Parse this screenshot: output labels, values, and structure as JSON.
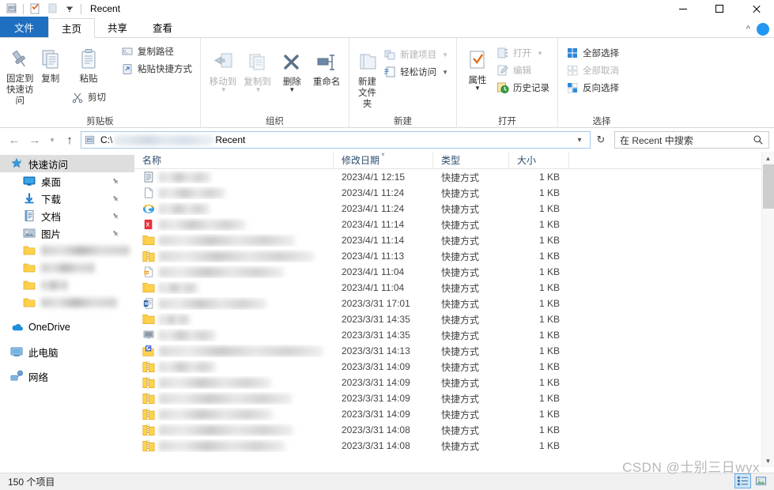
{
  "window": {
    "title": "Recent",
    "quick_access": [
      "properties-icon",
      "new-folder-icon",
      "customize-icon"
    ],
    "controls": {
      "minimize": "—",
      "maximize": "□",
      "close": "✕"
    }
  },
  "tabs": [
    {
      "id": "file",
      "label": "文件"
    },
    {
      "id": "home",
      "label": "主页"
    },
    {
      "id": "share",
      "label": "共享"
    },
    {
      "id": "view",
      "label": "查看"
    }
  ],
  "ribbon": {
    "groups": [
      {
        "title": "剪贴板",
        "big": [
          {
            "label": "固定到快速访问",
            "icon": "pin-icon"
          },
          {
            "label": "复制",
            "icon": "copy-icon"
          },
          {
            "label": "粘贴",
            "icon": "paste-icon"
          }
        ],
        "small_under_paste": [
          {
            "label": "剪切",
            "icon": "scissors-icon"
          }
        ],
        "small": [
          {
            "label": "复制路径",
            "icon": "copy-path-icon"
          },
          {
            "label": "粘贴快捷方式",
            "icon": "paste-shortcut-icon"
          }
        ]
      },
      {
        "title": "组织",
        "big": [
          {
            "label": "移动到",
            "icon": "move-to-icon",
            "has_caret": true,
            "disabled": true
          },
          {
            "label": "复制到",
            "icon": "copy-to-icon",
            "has_caret": true,
            "disabled": true
          },
          {
            "label": "删除",
            "icon": "delete-icon",
            "has_caret": true
          },
          {
            "label": "重命名",
            "icon": "rename-icon"
          }
        ]
      },
      {
        "title": "新建",
        "big": [
          {
            "label": "新建文件夹",
            "icon": "new-folder-icon"
          }
        ],
        "small": [
          {
            "label": "新建项目",
            "icon": "new-item-icon",
            "has_caret": true,
            "disabled": true
          },
          {
            "label": "轻松访问",
            "icon": "easy-access-icon",
            "has_caret": true
          }
        ]
      },
      {
        "title": "打开",
        "big": [
          {
            "label": "属性",
            "icon": "properties-icon",
            "has_caret": true
          }
        ],
        "small": [
          {
            "label": "打开",
            "icon": "open-icon",
            "has_caret": true,
            "disabled": true
          },
          {
            "label": "编辑",
            "icon": "edit-icon",
            "disabled": true
          },
          {
            "label": "历史记录",
            "icon": "history-icon"
          }
        ]
      },
      {
        "title": "选择",
        "small": [
          {
            "label": "全部选择",
            "icon": "select-all-icon"
          },
          {
            "label": "全部取消",
            "icon": "select-none-icon",
            "disabled": true
          },
          {
            "label": "反向选择",
            "icon": "invert-selection-icon"
          }
        ]
      }
    ]
  },
  "navbar": {
    "back_icon": "back-arrow-icon",
    "forward_icon": "forward-arrow-icon",
    "recent_icon": "recent-locations-icon",
    "up_icon": "up-arrow-icon",
    "address_prefix": "C:\\",
    "address_suffix": "Recent",
    "address_redacted": true,
    "dropdown_icon": "chevron-down-icon",
    "refresh_icon": "refresh-icon",
    "search_placeholder": "在 Recent 中搜索",
    "search_value": "",
    "search_icon": "search-icon"
  },
  "sidebar": {
    "items": [
      {
        "label": "快速访问",
        "icon": "star-quick-access-icon",
        "selected": true,
        "level": 0
      },
      {
        "label": "桌面",
        "icon": "desktop-icon",
        "pinned": true,
        "level": 1
      },
      {
        "label": "下载",
        "icon": "downloads-icon",
        "pinned": true,
        "level": 1
      },
      {
        "label": "文档",
        "icon": "documents-icon",
        "pinned": true,
        "level": 1
      },
      {
        "label": "图片",
        "icon": "pictures-icon",
        "pinned": true,
        "level": 1
      },
      {
        "label": "",
        "icon": "folder-icon",
        "redacted": true,
        "redacted_width": 112,
        "level": 1
      },
      {
        "label": "",
        "icon": "folder-icon",
        "redacted": true,
        "redacted_width": 68,
        "level": 1
      },
      {
        "label": "",
        "icon": "folder-icon",
        "redacted": true,
        "redacted_width": 34,
        "level": 1
      },
      {
        "label": "",
        "icon": "folder-icon",
        "redacted": true,
        "redacted_width": 96,
        "level": 1
      },
      {
        "label": "OneDrive",
        "icon": "onedrive-icon",
        "level": 0,
        "gap_before": true
      },
      {
        "label": "此电脑",
        "icon": "this-pc-icon",
        "level": 0,
        "gap_before": true
      },
      {
        "label": "网络",
        "icon": "network-icon",
        "level": 0,
        "gap_before": true
      }
    ]
  },
  "filelist": {
    "columns": [
      {
        "key": "name",
        "label": "名称"
      },
      {
        "key": "date",
        "label": "修改日期",
        "sorted": true,
        "sort_dir": "asc"
      },
      {
        "key": "type",
        "label": "类型"
      },
      {
        "key": "size",
        "label": "大小"
      }
    ],
    "rows": [
      {
        "icon": "text-document-icon",
        "name": "",
        "redacted_width": 66,
        "date": "2023/4/1 12:15",
        "type": "快捷方式",
        "size": "1 KB"
      },
      {
        "icon": "blank-document-icon",
        "name": "",
        "redacted_width": 84,
        "date": "2023/4/1 11:24",
        "type": "快捷方式",
        "size": "1 KB"
      },
      {
        "icon": "internet-explorer-icon",
        "name": "",
        "redacted_width": 64,
        "date": "2023/4/1 11:24",
        "type": "快捷方式",
        "size": "1 KB"
      },
      {
        "icon": "xmind-icon",
        "name": "",
        "redacted_width": 110,
        "date": "2023/4/1 11:14",
        "type": "快捷方式",
        "size": "1 KB"
      },
      {
        "icon": "folder-icon",
        "name": "",
        "redacted_width": 172,
        "date": "2023/4/1 11:14",
        "type": "快捷方式",
        "size": "1 KB"
      },
      {
        "icon": "zip-folder-icon",
        "name": "",
        "redacted_width": 196,
        "date": "2023/4/1 11:13",
        "type": "快捷方式",
        "size": "1 KB"
      },
      {
        "icon": "pdf-icon",
        "name": "",
        "redacted_width": 158,
        "date": "2023/4/1 11:04",
        "type": "快捷方式",
        "size": "1 KB"
      },
      {
        "icon": "folder-icon",
        "name": "",
        "redacted_width": 50,
        "date": "2023/4/1 11:04",
        "type": "快捷方式",
        "size": "1 KB"
      },
      {
        "icon": "word-icon",
        "name": "",
        "redacted_width": 136,
        "date": "2023/3/31 17:01",
        "type": "快捷方式",
        "size": "1 KB"
      },
      {
        "icon": "folder-icon",
        "name": "",
        "redacted_width": 40,
        "date": "2023/3/31 14:35",
        "type": "快捷方式",
        "size": "1 KB"
      },
      {
        "icon": "ppt-icon",
        "name": "",
        "redacted_width": 72,
        "date": "2023/3/31 14:35",
        "type": "快捷方式",
        "size": "1 KB"
      },
      {
        "icon": "folder-shortcut-icon",
        "name": "",
        "redacted_width": 208,
        "date": "2023/3/31 14:13",
        "type": "快捷方式",
        "size": "1 KB"
      },
      {
        "icon": "zip-folder-icon",
        "name": "",
        "redacted_width": 72,
        "date": "2023/3/31 14:09",
        "type": "快捷方式",
        "size": "1 KB"
      },
      {
        "icon": "zip-folder-icon",
        "name": "",
        "redacted_width": 142,
        "date": "2023/3/31 14:09",
        "type": "快捷方式",
        "size": "1 KB"
      },
      {
        "icon": "zip-folder-icon",
        "name": "",
        "redacted_width": 168,
        "date": "2023/3/31 14:09",
        "type": "快捷方式",
        "size": "1 KB"
      },
      {
        "icon": "zip-folder-icon",
        "name": "",
        "redacted_width": 144,
        "date": "2023/3/31 14:09",
        "type": "快捷方式",
        "size": "1 KB"
      },
      {
        "icon": "zip-folder-icon",
        "name": "",
        "redacted_width": 170,
        "date": "2023/3/31 14:08",
        "type": "快捷方式",
        "size": "1 KB"
      },
      {
        "icon": "zip-folder-icon",
        "name": "",
        "redacted_width": 160,
        "date": "2023/3/31 14:08",
        "type": "快捷方式",
        "size": "1 KB"
      }
    ]
  },
  "statusbar": {
    "item_count_text": "150 个项目",
    "views": [
      {
        "icon": "details-view-icon",
        "active": true
      },
      {
        "icon": "large-icons-view-icon",
        "active": false
      }
    ]
  },
  "watermark": "CSDN @士别三日wyx",
  "colors": {
    "file_tab_blue": "#1e6fbf",
    "selection_gray": "#dededf",
    "address_border": "#a5c8e8",
    "folder_yellow": "#ffd24d",
    "accent_blue": "#2196f3"
  }
}
